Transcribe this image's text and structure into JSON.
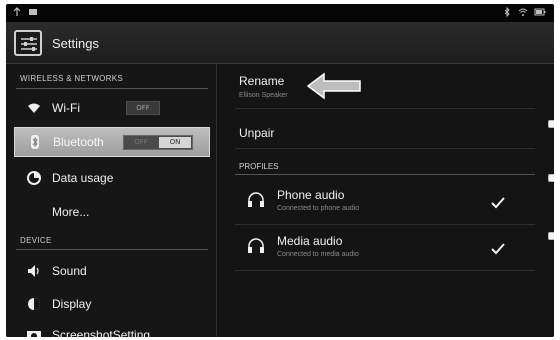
{
  "statusbar": {
    "icons_left": [
      "usb-icon",
      "notification-icon"
    ],
    "icons_right": [
      "bluetooth-icon",
      "wifi-icon",
      "battery-icon"
    ]
  },
  "actionbar": {
    "title": "Settings",
    "icon": "settings-sliders-icon"
  },
  "sections": {
    "wireless": "WIRELESS & NETWORKS",
    "device": "DEVICE"
  },
  "nav": {
    "wifi": {
      "label": "Wi-Fi",
      "icon": "wifi-icon",
      "toggle": "OFF"
    },
    "bluetooth": {
      "label": "Bluetooth",
      "icon": "bluetooth-icon",
      "toggle_on": "ON",
      "toggle_off": "OFF",
      "selected": true
    },
    "data_usage": {
      "label": "Data usage",
      "icon": "pie-chart-icon"
    },
    "more": {
      "label": "More..."
    },
    "sound": {
      "label": "Sound",
      "icon": "speaker-icon"
    },
    "display": {
      "label": "Display",
      "icon": "brightness-icon"
    },
    "screenshot": {
      "label": "ScreenshotSetting",
      "icon": "camera-icon"
    }
  },
  "detail": {
    "rename": {
      "title": "Rename",
      "subtitle": "Ellison Speaker"
    },
    "unpair": {
      "title": "Unpair"
    },
    "profiles_header": "PROFILES",
    "profiles": [
      {
        "label": "Phone audio",
        "subtitle": "Connected to phone audio",
        "icon": "headphones-icon",
        "checked": true
      },
      {
        "label": "Media audio",
        "subtitle": "Connected to media audio",
        "icon": "headphones-icon",
        "checked": true
      }
    ]
  },
  "colors": {
    "background": "#141414",
    "selected_bg": "#a8a8a8",
    "text": "#f0f0f0",
    "muted": "#8a8a8a"
  }
}
